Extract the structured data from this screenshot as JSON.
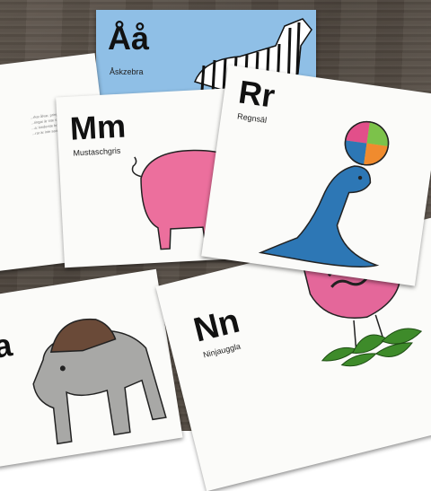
{
  "cards": {
    "aa": {
      "letters": "Åå",
      "word": "Åskzebra"
    },
    "mm": {
      "letters": "Mm",
      "word": "Mustaschgris"
    },
    "rr": {
      "letters": "Rr",
      "word": "Regnsäl"
    },
    "nn": {
      "letters": "Nn",
      "word": "Ninjauggla"
    },
    "back": {
      "text_lines": [
        "...rkar ålvar, pringet,",
        "...ringar är inte sant,",
        "...a: kinderste bruka",
        "...rar är inte sant."
      ]
    }
  },
  "colors": {
    "wood": "#524a42",
    "card_blue": "#8fbfe6",
    "pig_pink": "#ec6f9d",
    "seal_blue": "#2d77b5",
    "moose_grey": "#a8a8a6",
    "antler_brown": "#6a4a38",
    "owl_pink": "#e4679a",
    "leaf_green": "#3e8b2a"
  }
}
